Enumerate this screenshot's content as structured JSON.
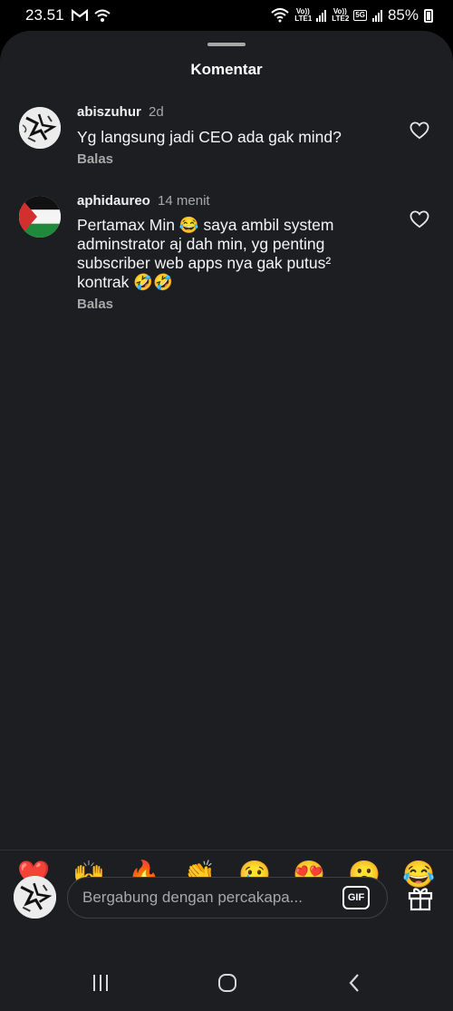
{
  "status_bar": {
    "time": "23.51",
    "sim1_label": "Vo)) LTE1",
    "sim2_label": "Vo)) LTE2",
    "network_badge": "5G",
    "battery": "85%",
    "icons": [
      "gmail-icon",
      "wifi-calling-icon",
      "wifi-icon",
      "signal-icon",
      "battery-icon"
    ]
  },
  "sheet": {
    "title": "Komentar"
  },
  "comments": [
    {
      "username": "abiszuhur",
      "time": "2d",
      "text": "Yg langsung jadi CEO ada gak mind?",
      "reply_label": "Balas",
      "avatar": "drawing-avatar"
    },
    {
      "username": "aphidaureo",
      "time": "14 menit",
      "text": "Pertamax Min 😂 saya ambil system adminstrator aj dah min, yg penting subscriber web apps nya gak putus² kontrak 🤣🤣",
      "reply_label": "Balas",
      "avatar": "palestine-flag-avatar"
    }
  ],
  "reactions": [
    "❤️",
    "🙌",
    "🔥",
    "👏",
    "😢",
    "😍",
    "😮",
    "😂"
  ],
  "composer": {
    "placeholder": "Bergabung dengan percakapa...",
    "gif_label": "GIF"
  },
  "nav": {
    "buttons": [
      "recent-apps-icon",
      "home-icon",
      "back-icon"
    ]
  },
  "colors": {
    "sheet_bg": "#1c1e22",
    "status_bg": "#000000",
    "text_primary": "#f5f5f5",
    "text_secondary": "#a8a8a8"
  }
}
